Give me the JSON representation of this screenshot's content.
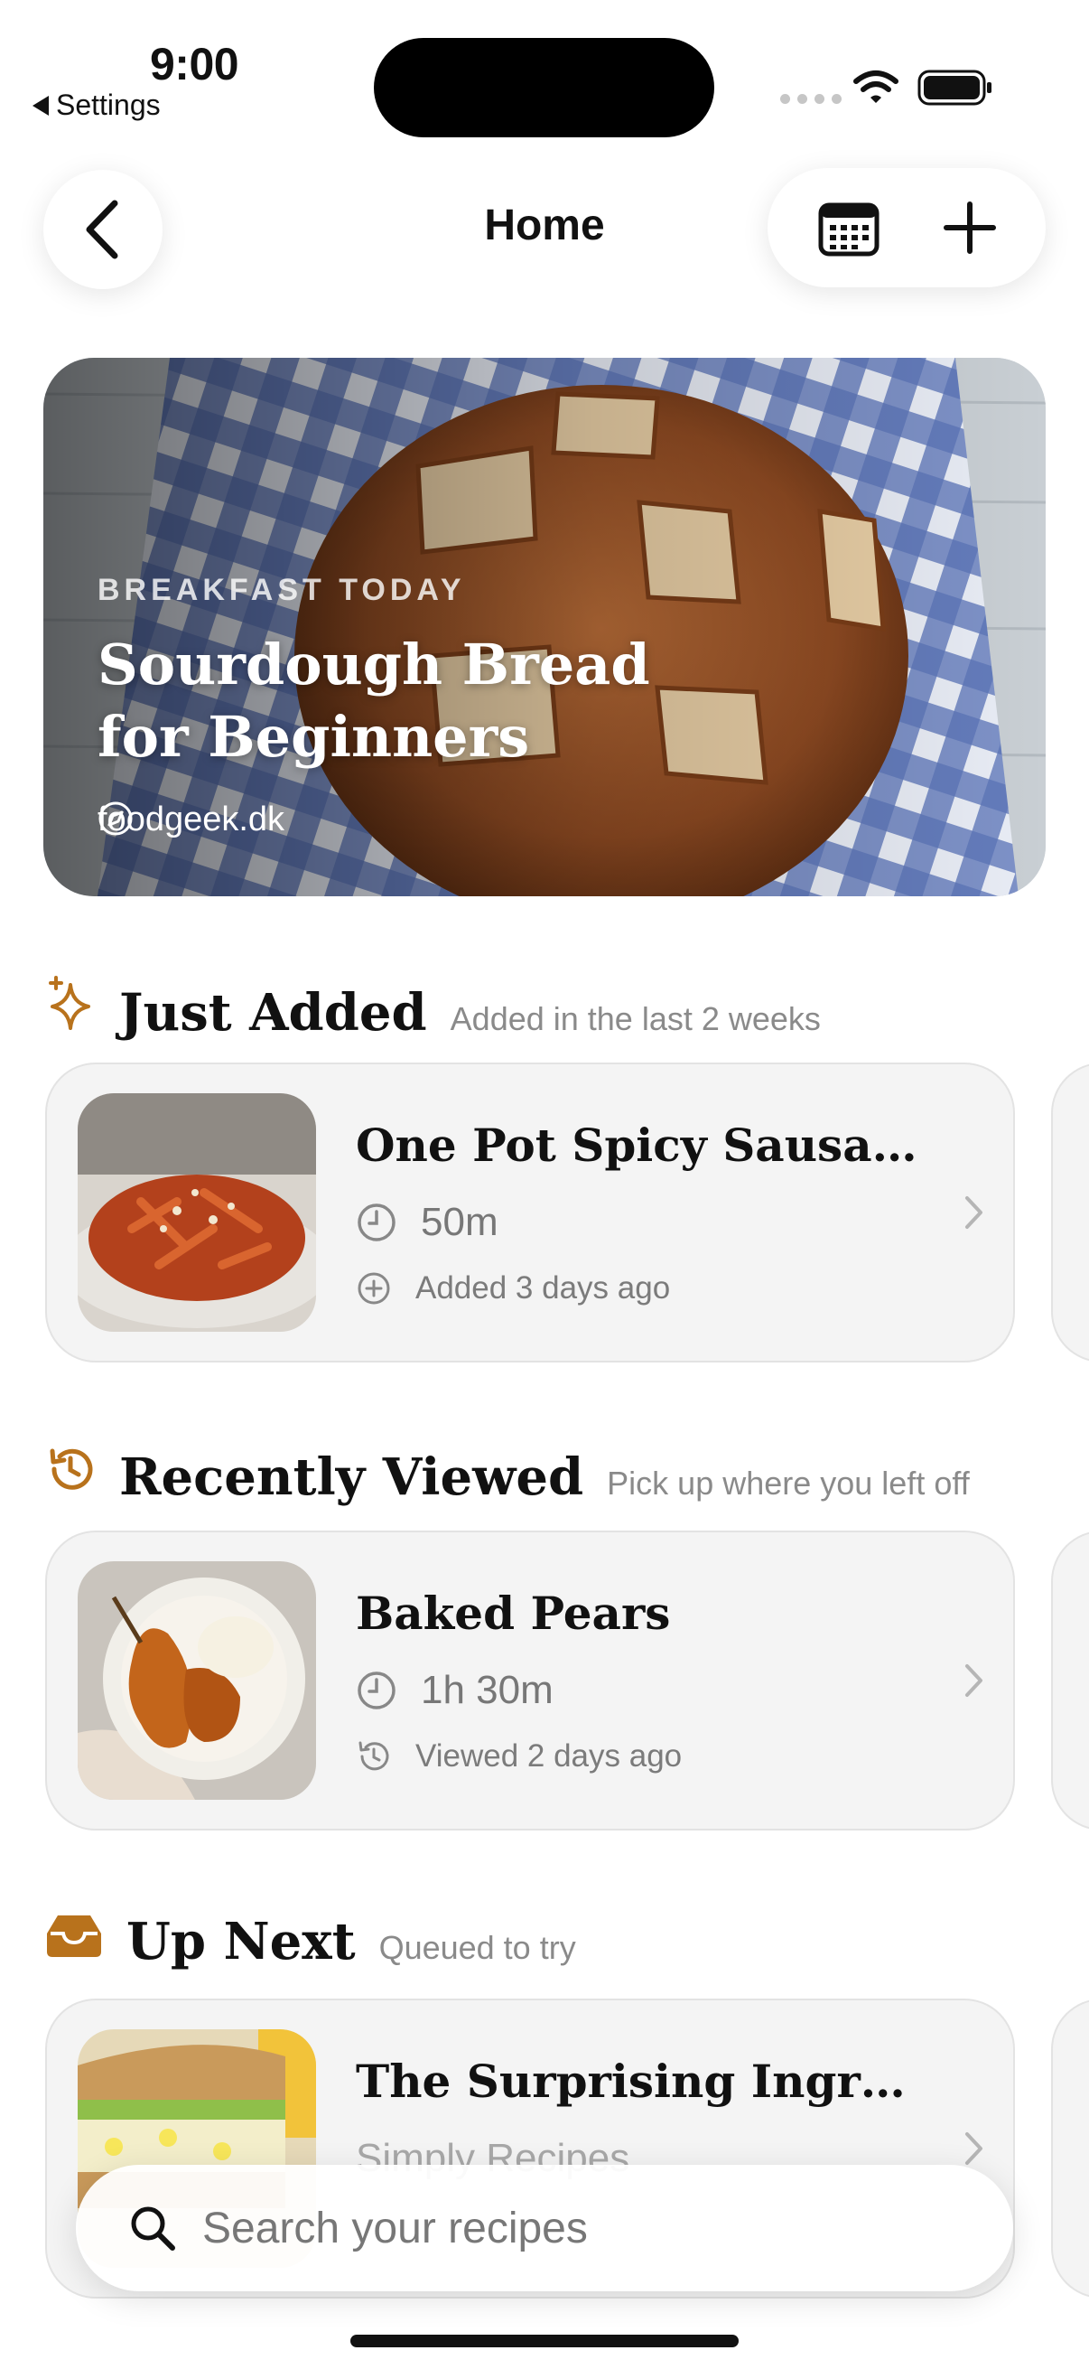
{
  "status_bar": {
    "time": "9:00",
    "back_app": "Settings"
  },
  "nav": {
    "title": "Home"
  },
  "hero": {
    "eyebrow": "BREAKFAST TODAY",
    "title": "Sourdough Bread for Beginners",
    "source": "foodgeek.dk"
  },
  "sections": {
    "just_added": {
      "title": "Just Added",
      "subtitle": "Added in the last 2 weeks",
      "card": {
        "title": "One Pot Spicy Sausage...",
        "time": "50m",
        "meta": "Added 3 days ago"
      }
    },
    "recently_viewed": {
      "title": "Recently Viewed",
      "subtitle": "Pick up where you left off",
      "card": {
        "title": "Baked Pears",
        "time": "1h 30m",
        "meta": "Viewed 2 days ago"
      }
    },
    "up_next": {
      "title": "Up Next",
      "subtitle": "Queued to try",
      "card": {
        "title": "The Surprising Ingredi...",
        "source": "Simply Recipes"
      }
    }
  },
  "search": {
    "placeholder": "Search your recipes"
  },
  "colors": {
    "accent": "#b8721c",
    "card_bg": "#f4f4f4",
    "text": "#111111"
  },
  "icons": [
    "back-chevron-icon",
    "calendar-icon",
    "plus-icon",
    "compass-icon",
    "sparkles-icon",
    "history-icon",
    "inbox-tray-icon",
    "clock-icon",
    "plus-circle-icon",
    "chevron-right-icon",
    "search-icon",
    "wifi-icon",
    "battery-icon"
  ]
}
